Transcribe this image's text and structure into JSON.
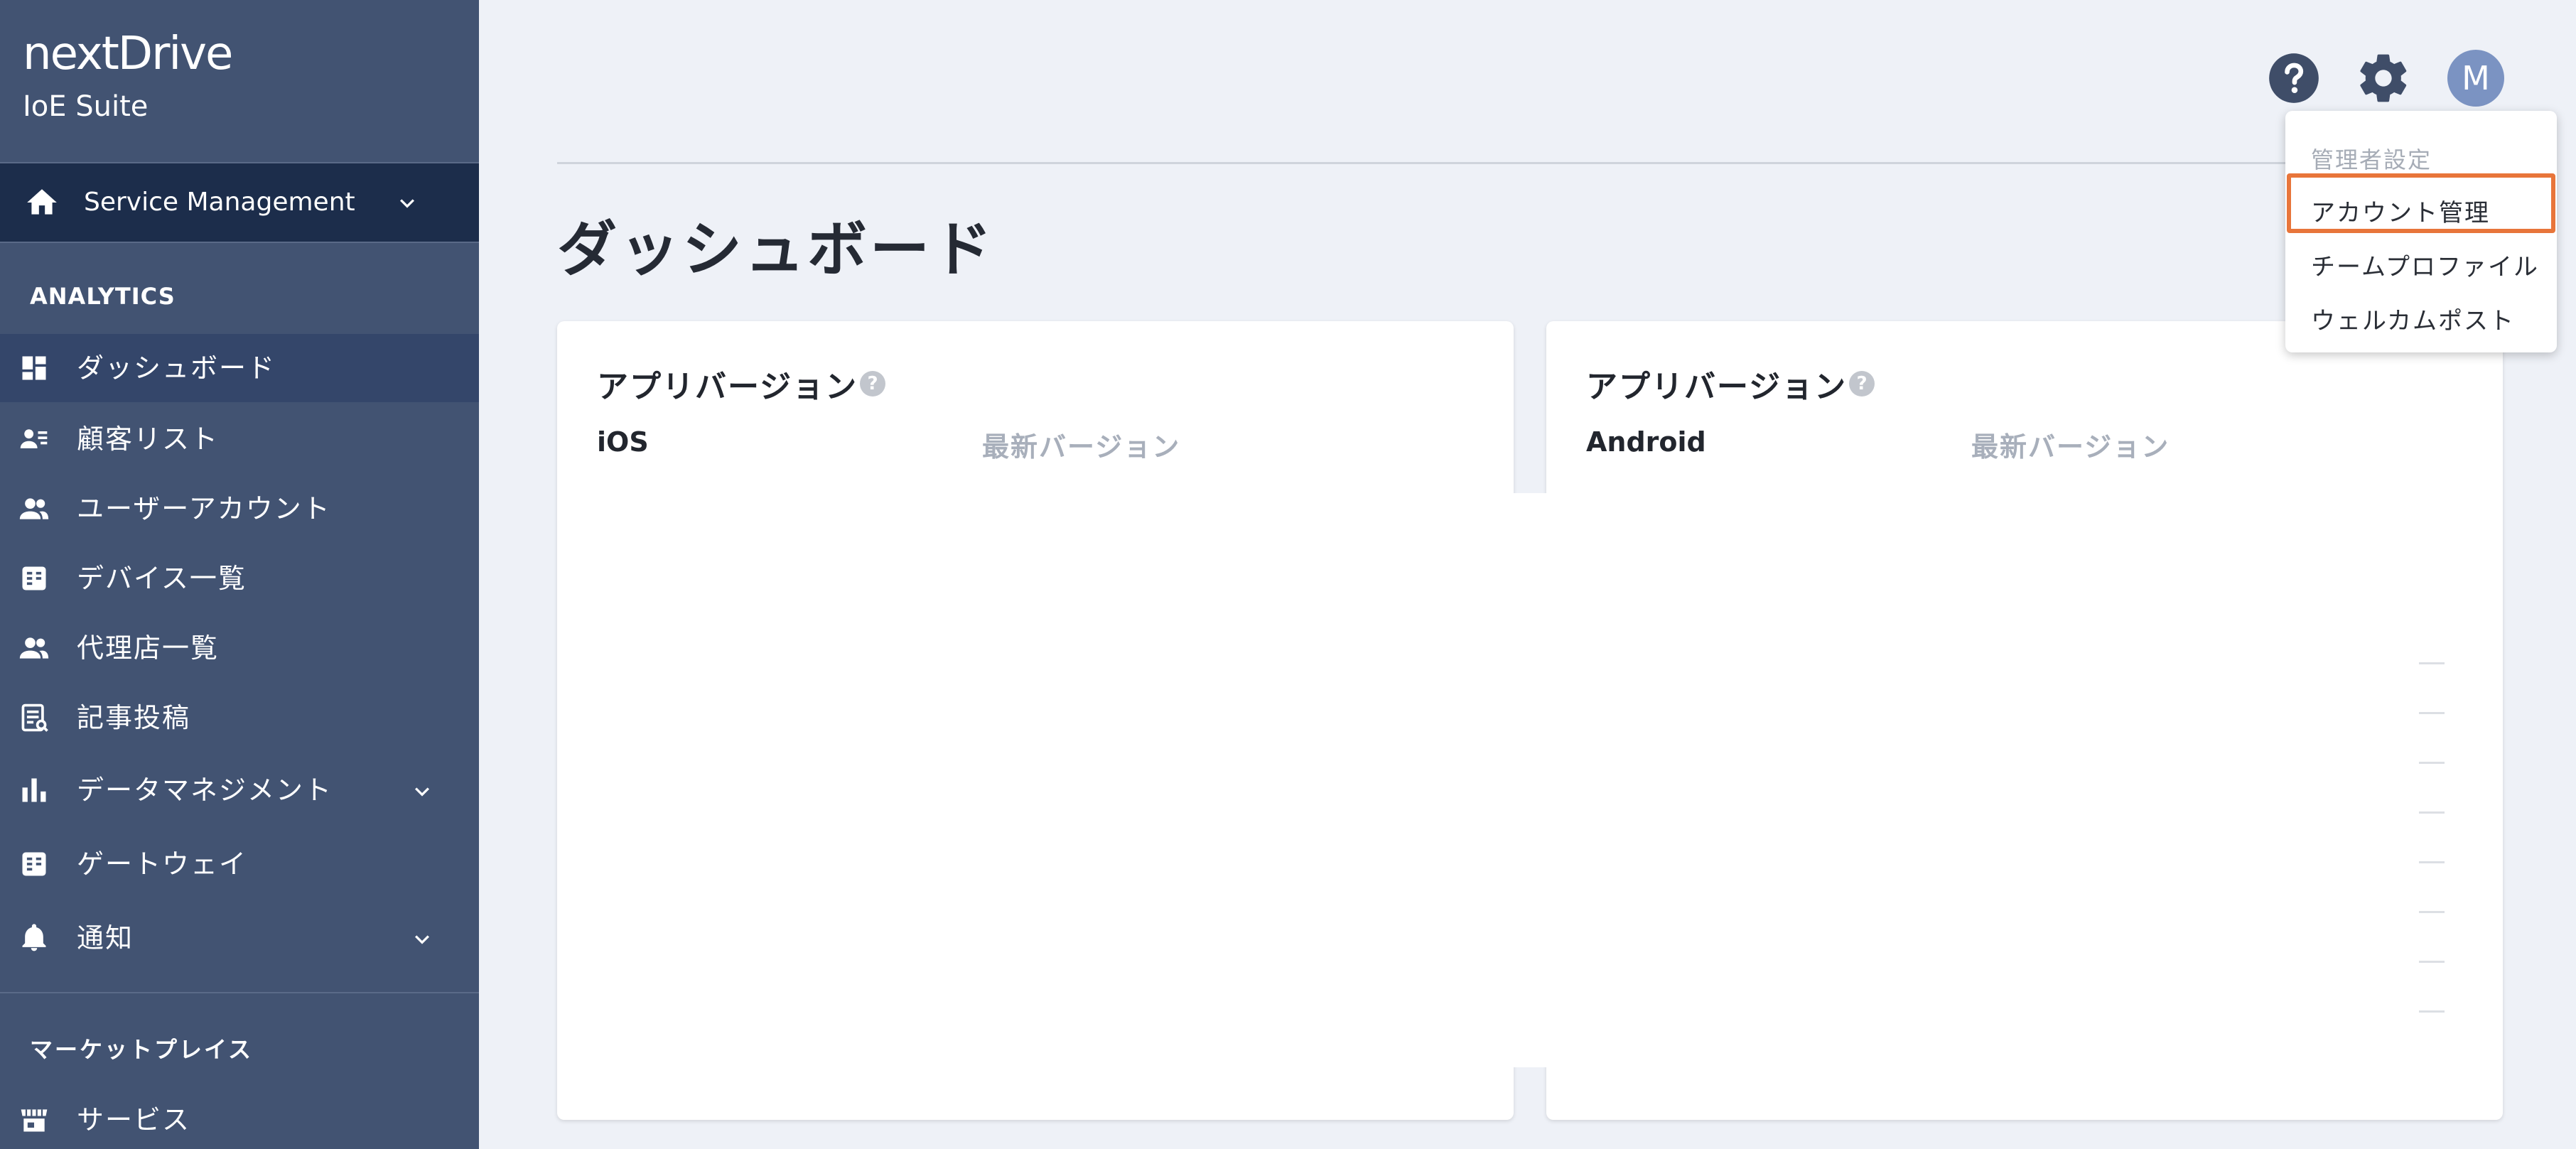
{
  "brand": {
    "logo": "nextDrive",
    "subtitle": "IoE Suite"
  },
  "service_selector": {
    "label": "Service Management"
  },
  "sidebar": {
    "section_analytics": "ANALYTICS",
    "items": [
      {
        "label": "ダッシュボード",
        "icon": "dashboard-icon",
        "active": true
      },
      {
        "label": "顧客リスト",
        "icon": "contact-list-icon"
      },
      {
        "label": "ユーザーアカウント",
        "icon": "users-icon"
      },
      {
        "label": "デバイス一覧",
        "icon": "device-list-icon"
      },
      {
        "label": "代理店一覧",
        "icon": "agency-icon"
      },
      {
        "label": "記事投稿",
        "icon": "article-icon"
      },
      {
        "label": "データマネジメント",
        "icon": "bar-chart-icon",
        "expandable": true
      },
      {
        "label": "ゲートウェイ",
        "icon": "gateway-icon"
      },
      {
        "label": "通知",
        "icon": "bell-icon",
        "expandable": true
      }
    ],
    "section_marketplace": "マーケットプレイス",
    "marketplace_items": [
      {
        "label": "サービス",
        "icon": "store-icon"
      }
    ]
  },
  "header": {
    "help_icon": "help-circle-icon",
    "settings_icon": "gear-icon",
    "avatar_initial": "M"
  },
  "page": {
    "title": "ダッシュボード"
  },
  "cards": [
    {
      "title": "アプリバージョン",
      "platform": "iOS",
      "latest_label": "最新バージョン"
    },
    {
      "title": "アプリバージョン",
      "platform": "Android",
      "latest_label": "最新バージョン"
    }
  ],
  "dropdown": {
    "header": "管理者設定",
    "items": [
      "アカウント管理",
      "チームプロファイル",
      "ウェルカムポスト"
    ],
    "highlight_color": "#e8753a"
  },
  "colors": {
    "sidebar_bg": "#425372",
    "sidebar_selected_bg": "#1c2d4b",
    "page_bg": "#eef1f7"
  }
}
